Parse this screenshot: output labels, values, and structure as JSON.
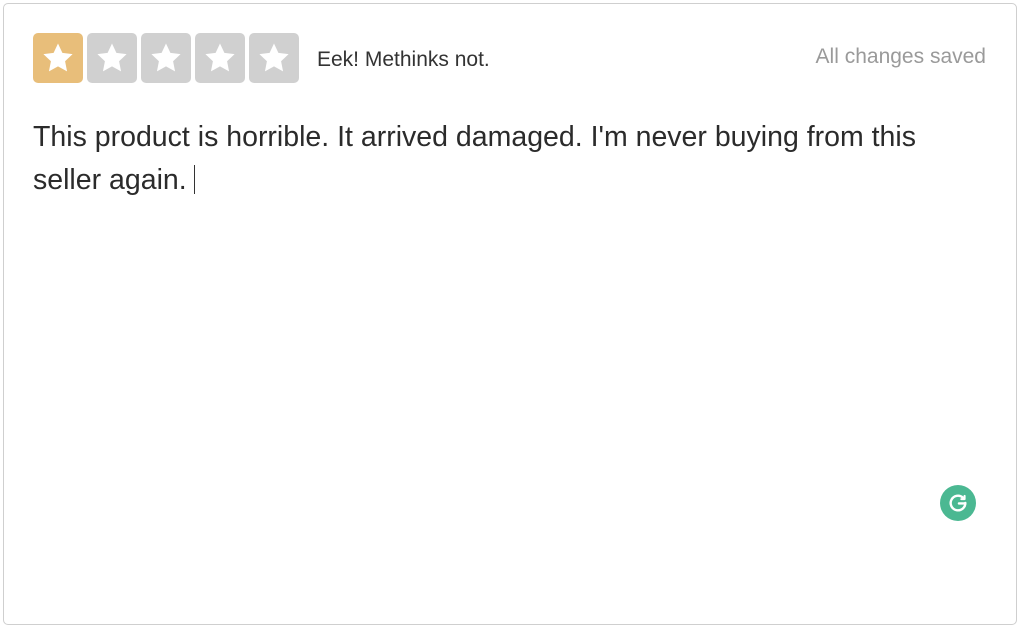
{
  "rating": {
    "value": 1,
    "max": 5,
    "label": "Eek! Methinks not.",
    "colors": {
      "active": "#E8BE7A",
      "inactive": "#D0D0D0",
      "star": "#FFFFFF"
    },
    "stars": [
      {
        "index": 1,
        "state": "filled"
      },
      {
        "index": 2,
        "state": "empty"
      },
      {
        "index": 3,
        "state": "empty"
      },
      {
        "index": 4,
        "state": "empty"
      },
      {
        "index": 5,
        "state": "empty"
      }
    ]
  },
  "status": {
    "text": "All changes saved"
  },
  "review": {
    "text": "This product is horrible. It arrived damaged. I'm never buying from this seller again."
  },
  "grammarly": {
    "icon": "grammarly-icon",
    "color": "#4BB892"
  }
}
